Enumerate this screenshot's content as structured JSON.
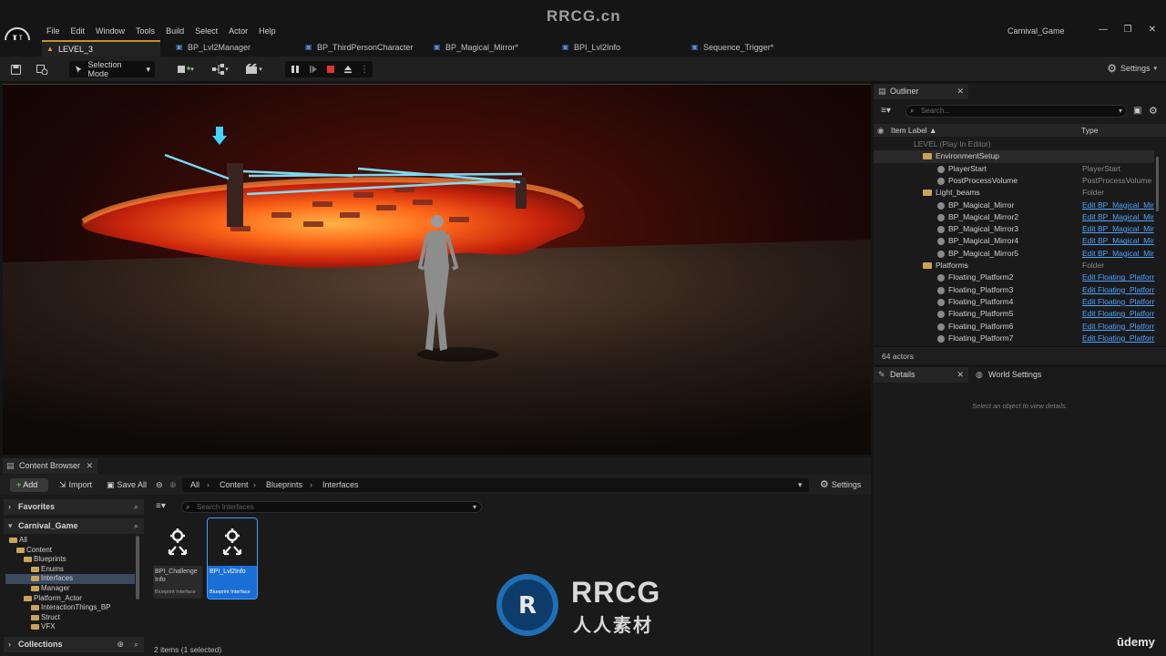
{
  "app": {
    "project_name": "Carnival_Game",
    "watermark_top": "RRCG.cn",
    "watermark_brand": "RRCG",
    "watermark_cn": "人人素材",
    "udemy": "ūdemy"
  },
  "menu": [
    "File",
    "Edit",
    "Window",
    "Tools",
    "Build",
    "Select",
    "Actor",
    "Help"
  ],
  "tabs": [
    {
      "label": "LEVEL_3",
      "active": true
    },
    {
      "label": "BP_Lvl2Manager"
    },
    {
      "label": "BP_ThirdPersonCharacter"
    },
    {
      "label": "BP_Magical_Mirror*"
    },
    {
      "label": "BPI_Lvl2Info"
    },
    {
      "label": "Sequence_Trigger*"
    }
  ],
  "toolbar": {
    "selection_mode": "Selection Mode",
    "settings": "Settings"
  },
  "outliner": {
    "tab": "Outliner",
    "search_placeholder": "Search...",
    "col_label": "Item Label ▲",
    "col_type": "Type",
    "rows": [
      {
        "label": "LEVEL (Play In Editor)",
        "type": "",
        "indent": 0,
        "kind": "dim"
      },
      {
        "label": "EnvironmentSetup",
        "type": "",
        "indent": 1,
        "kind": "folder"
      },
      {
        "label": "PlayerStart",
        "type": "PlayerStart",
        "indent": 2,
        "kind": "actor"
      },
      {
        "label": "PostProcessVolume",
        "type": "PostProcessVolume",
        "indent": 2,
        "kind": "actor"
      },
      {
        "label": "Light_beams",
        "type": "Folder",
        "indent": 1,
        "kind": "folder"
      },
      {
        "label": "BP_Magical_Mirror",
        "type": "Edit BP_Magical_Mir",
        "indent": 2,
        "kind": "bp"
      },
      {
        "label": "BP_Magical_Mirror2",
        "type": "Edit BP_Magical_Mir",
        "indent": 2,
        "kind": "bp"
      },
      {
        "label": "BP_Magical_Mirror3",
        "type": "Edit BP_Magical_Mir",
        "indent": 2,
        "kind": "bp"
      },
      {
        "label": "BP_Magical_Mirror4",
        "type": "Edit BP_Magical_Mir",
        "indent": 2,
        "kind": "bp"
      },
      {
        "label": "BP_Magical_Mirror5",
        "type": "Edit BP_Magical_Mir",
        "indent": 2,
        "kind": "bp"
      },
      {
        "label": "Platforms",
        "type": "Folder",
        "indent": 1,
        "kind": "folder"
      },
      {
        "label": "Floating_Platform2",
        "type": "Edit Floating_Platforr",
        "indent": 2,
        "kind": "bp"
      },
      {
        "label": "Floating_Platform3",
        "type": "Edit Floating_Platforr",
        "indent": 2,
        "kind": "bp"
      },
      {
        "label": "Floating_Platform4",
        "type": "Edit Floating_Platforr",
        "indent": 2,
        "kind": "bp"
      },
      {
        "label": "Floating_Platform5",
        "type": "Edit Floating_Platforr",
        "indent": 2,
        "kind": "bp"
      },
      {
        "label": "Floating_Platform6",
        "type": "Edit Floating_Platforr",
        "indent": 2,
        "kind": "bp"
      },
      {
        "label": "Floating_Platform7",
        "type": "Edit Floating_Platforr",
        "indent": 2,
        "kind": "bp"
      }
    ],
    "actor_count": "64 actors"
  },
  "details": {
    "tab": "Details",
    "world_settings_tab": "World Settings",
    "hint": "Select an object to view details."
  },
  "content_browser": {
    "tab": "Content Browser",
    "add": "Add",
    "import": "Import",
    "save_all": "Save All",
    "settings": "Settings",
    "breadcrumb": [
      "All",
      "Content",
      "Blueprints",
      "Interfaces"
    ],
    "favorites": "Favorites",
    "project_section": "Carnival_Game",
    "collections": "Collections",
    "search_placeholder": "Search Interfaces",
    "tree": [
      {
        "label": "All",
        "indent": 0
      },
      {
        "label": "Content",
        "indent": 1
      },
      {
        "label": "Blueprints",
        "indent": 2
      },
      {
        "label": "Enums",
        "indent": 3
      },
      {
        "label": "Interfaces",
        "indent": 3,
        "selected": true
      },
      {
        "label": "Manager",
        "indent": 3
      },
      {
        "label": "Platform_Actor",
        "indent": 2
      },
      {
        "label": "InteractionThings_BP",
        "indent": 3
      },
      {
        "label": "Struct",
        "indent": 3
      },
      {
        "label": "VFX",
        "indent": 3
      }
    ],
    "assets": [
      {
        "name": "BPI_Challenge Info",
        "class": "Blueprint Interface",
        "selected": false
      },
      {
        "name": "BPI_Lvl2Info",
        "class": "Blueprint Interface",
        "selected": true
      }
    ],
    "status": "2 items (1 selected)"
  }
}
